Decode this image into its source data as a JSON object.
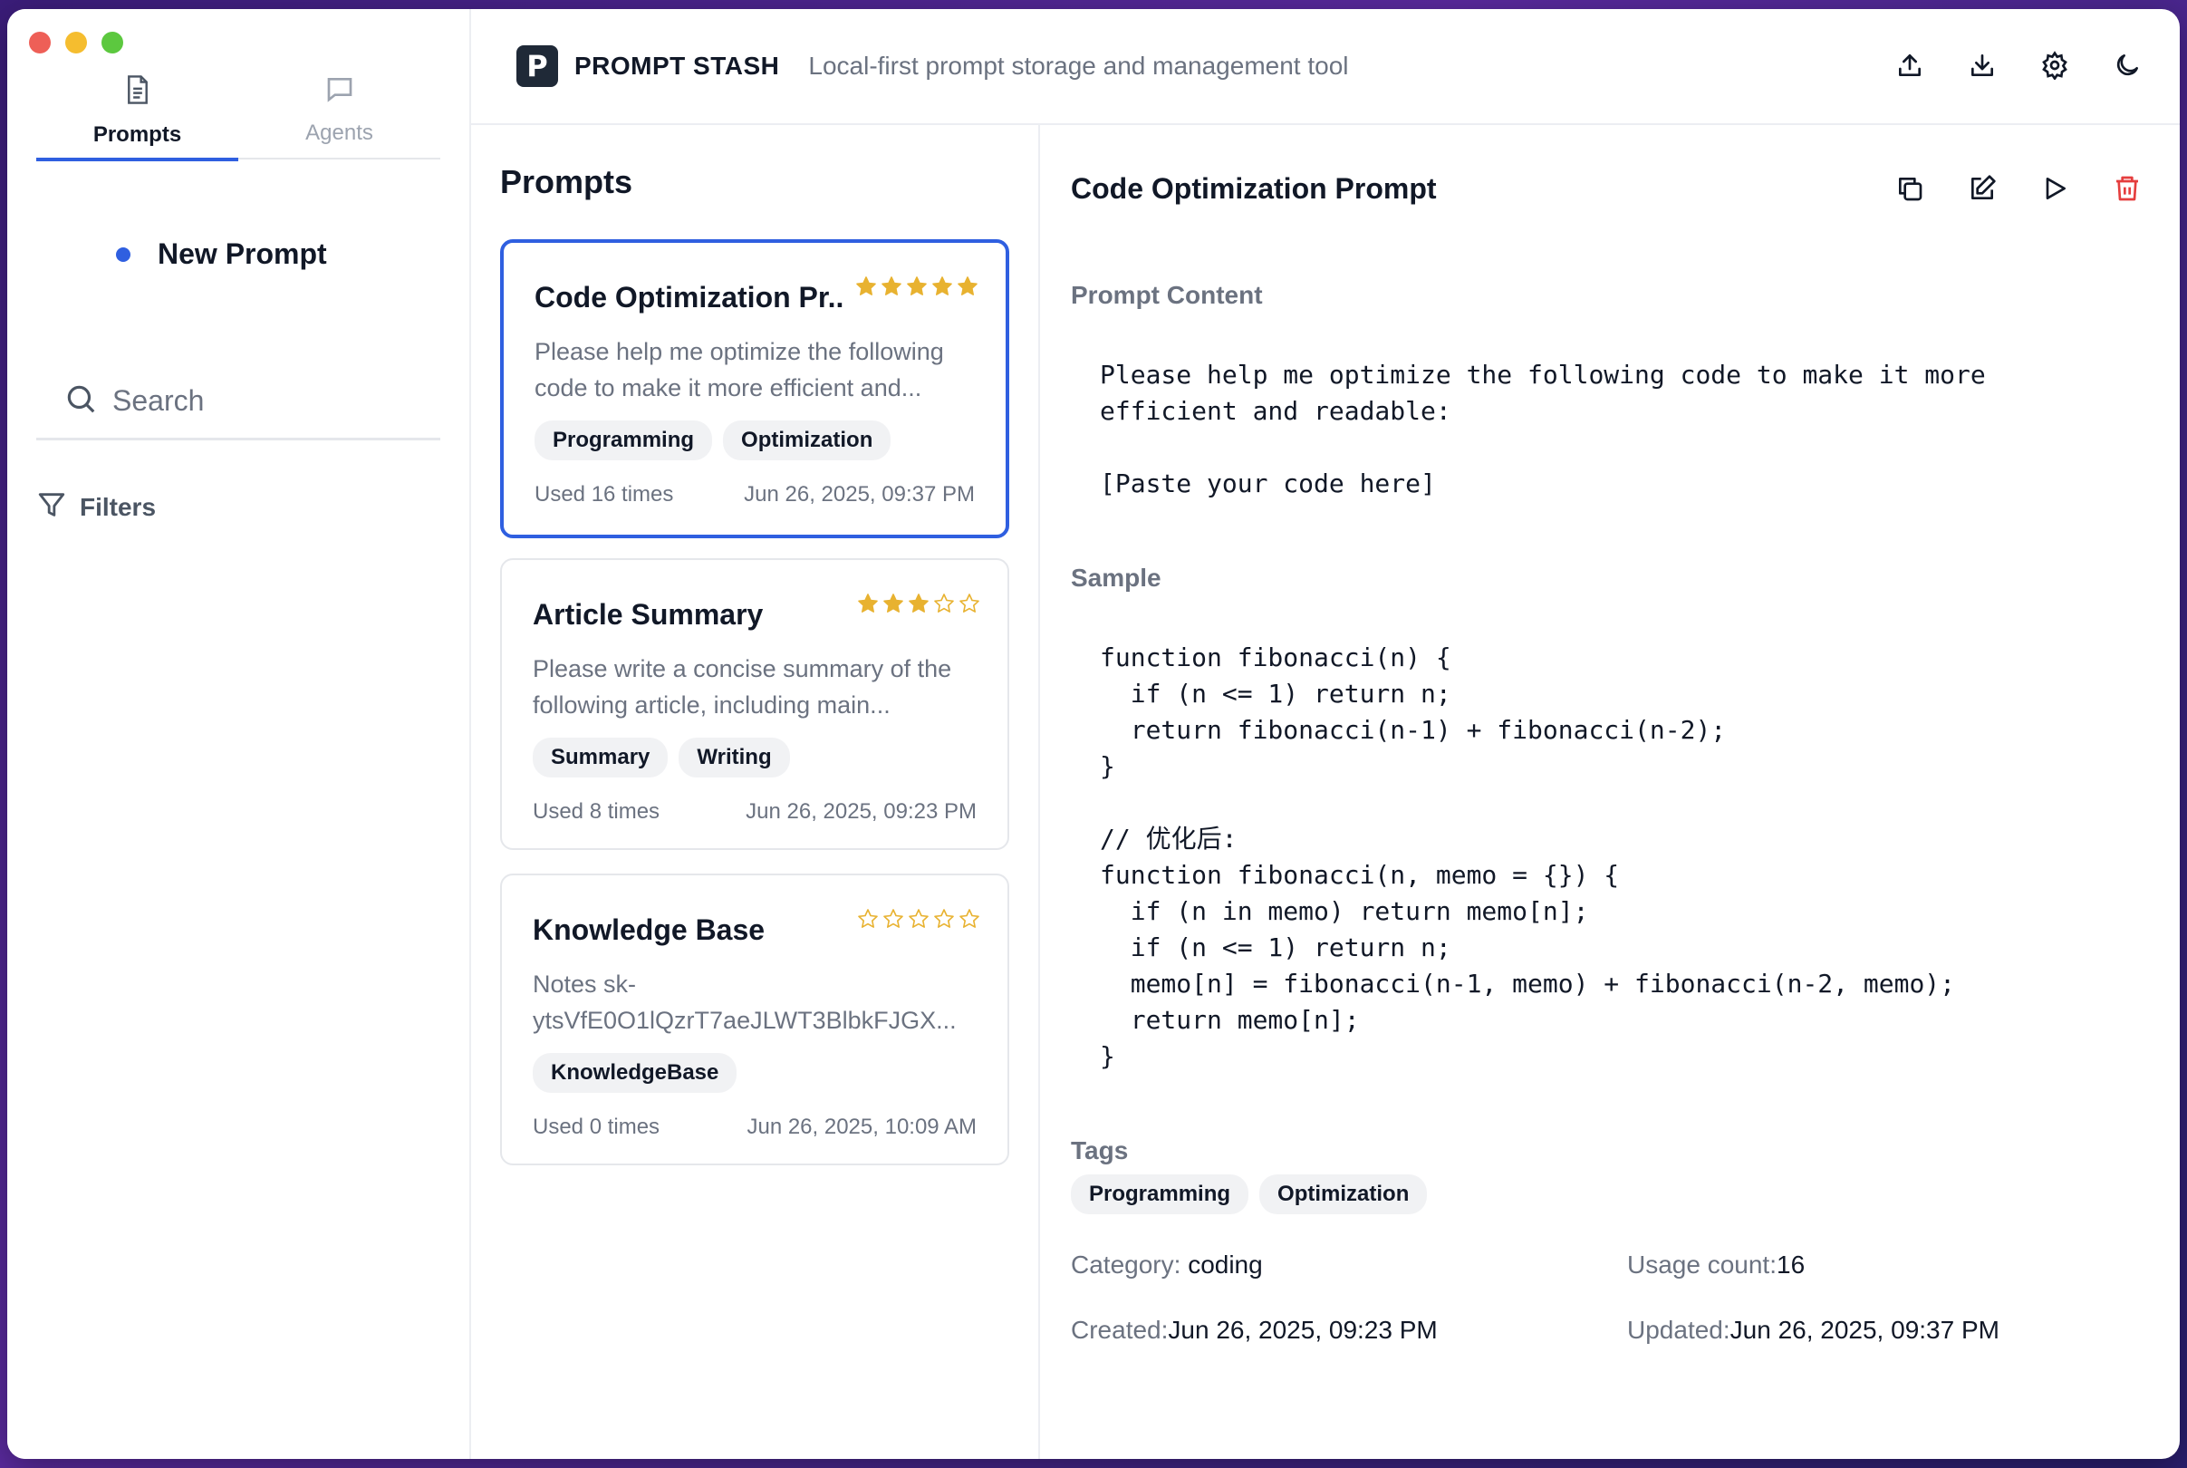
{
  "sidebar": {
    "tabs": [
      {
        "label": "Prompts",
        "icon": "document-icon",
        "active": true
      },
      {
        "label": "Agents",
        "icon": "chat-icon",
        "active": false
      }
    ],
    "new_prompt": "New Prompt",
    "search_placeholder": "Search",
    "filters": "Filters"
  },
  "header": {
    "logo_letter": "P",
    "app_name": "PROMPT STASH",
    "subtitle": "Local-first prompt storage and management tool",
    "actions": [
      "upload-icon",
      "download-icon",
      "settings-icon",
      "dark-mode-icon"
    ]
  },
  "list": {
    "title": "Prompts",
    "cards": [
      {
        "title": "Code Optimization Pr...",
        "rating": 5,
        "description": "Please help me optimize the following code to make it more efficient and...",
        "tags": [
          "Programming",
          "Optimization"
        ],
        "usage": "Used 16 times",
        "date": "Jun 26, 2025, 09:37 PM",
        "selected": true
      },
      {
        "title": "Article Summary",
        "rating": 3,
        "description": "Please write a concise summary of the following article, including main...",
        "tags": [
          "Summary",
          "Writing"
        ],
        "usage": "Used 8 times",
        "date": "Jun 26, 2025, 09:23 PM",
        "selected": false
      },
      {
        "title": "Knowledge Base",
        "rating": 0,
        "description": "Notes sk-ytsVfE0O1lQzrT7aeJLWT3BlbkFJGX...",
        "tags": [
          "KnowledgeBase"
        ],
        "usage": "Used 0 times",
        "date": "Jun 26, 2025, 10:09 AM",
        "selected": false
      }
    ]
  },
  "detail": {
    "title": "Code Optimization Prompt",
    "actions": [
      "copy-icon",
      "edit-icon",
      "play-icon",
      "trash-icon"
    ],
    "content_label": "Prompt Content",
    "content": "Please help me optimize the following code to make it more\nefficient and readable:\n\n[Paste your code here]",
    "sample_label": "Sample",
    "sample": "function fibonacci(n) {\n  if (n <= 1) return n;\n  return fibonacci(n-1) + fibonacci(n-2);\n}\n\n// 优化后:\nfunction fibonacci(n, memo = {}) {\n  if (n in memo) return memo[n];\n  if (n <= 1) return n;\n  memo[n] = fibonacci(n-1, memo) + fibonacci(n-2, memo);\n  return memo[n];\n}",
    "tags_label": "Tags",
    "tags": [
      "Programming",
      "Optimization"
    ],
    "category_label": "Category:",
    "category": "coding",
    "usage_label": "Usage count:",
    "usage": "16",
    "created_label": "Created:",
    "created": "Jun 26, 2025, 09:23 PM",
    "updated_label": "Updated:",
    "updated": "Jun 26, 2025, 09:37 PM"
  },
  "colors": {
    "accent": "#2f5fe0",
    "star": "#e8b230",
    "danger": "#e53e3e"
  }
}
